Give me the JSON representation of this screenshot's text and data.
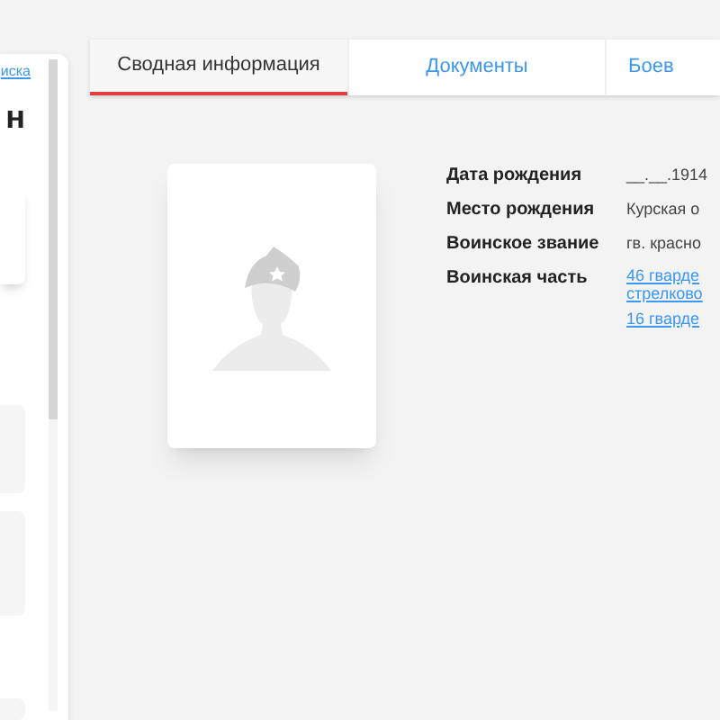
{
  "sidebar": {
    "link": "иска",
    "heading": "н"
  },
  "tabs": [
    {
      "label": "Сводная информация",
      "selected": true
    },
    {
      "label": "Документы",
      "selected": false
    },
    {
      "label": "Боев",
      "selected": false
    }
  ],
  "fields": [
    {
      "label": "Дата рождения",
      "values": [
        {
          "kind": "text",
          "text": "__.__.1914"
        }
      ]
    },
    {
      "label": "Место рождения",
      "values": [
        {
          "kind": "text",
          "text": "Курская о"
        }
      ]
    },
    {
      "label": "Воинское звание",
      "values": [
        {
          "kind": "text",
          "text": "гв. красно"
        }
      ]
    },
    {
      "label": "Воинская часть",
      "values": [
        {
          "kind": "link",
          "lines": [
            "46 гварде",
            "стрелково"
          ]
        },
        {
          "kind": "link",
          "lines": [
            "16 гварде"
          ]
        }
      ]
    }
  ]
}
